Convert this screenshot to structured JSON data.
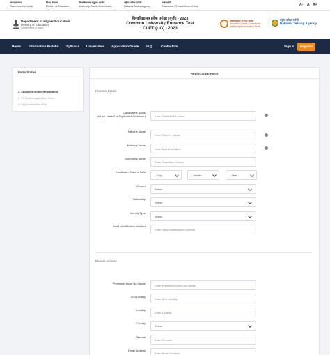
{
  "gov_links": [
    {
      "hi": "भारत सरकार",
      "en": "Government of India"
    },
    {
      "hi": "शिक्षा मंत्रालय",
      "en": "Ministry of Education"
    },
    {
      "hi": "विश्वविद्यालय अनुदान आयोग",
      "en": "University Grants Commission"
    },
    {
      "hi": "राष्ट्रीय परीक्षा एजेंसी",
      "en": "National Testing Agency"
    },
    {
      "hi": "आईआईटी",
      "en": "Grievance: IIT Institutions of Hed"
    }
  ],
  "accessibility": {
    "small": "A-",
    "normal": "A",
    "large": "A+"
  },
  "header": {
    "dept_name": "Department of Higher Education",
    "dept_sub": "Ministry of Education",
    "dept_gov": "Government of India",
    "title_hi": "विश्वविद्यालय प्रवेश परीक्षा (यूजी) - 2023",
    "title_1": "Common University Entrance Test",
    "title_2": "CUET (UG) - 2023",
    "ugc_hi": "विश्वविद्यालय अनुदान आयोग",
    "ugc_en": "University Grants Commission",
    "ugc_tag": "quality higher education for all",
    "nta_hi": "राष्ट्रीय परीक्षा एजेंसी",
    "nta_en": "National Testing Agency"
  },
  "nav": {
    "items": [
      "Home",
      "Information Bulletin",
      "Syllabus",
      "Universities",
      "Application Guide",
      "FAQ",
      "Contact Us"
    ],
    "signin": "Sign In",
    "register": "Register"
  },
  "form_status": {
    "title": "Form Status",
    "steps": [
      "1. Apply for Online Registration",
      "2. Fill Online Application Form",
      "3. Pay Examination Fee"
    ]
  },
  "registration": {
    "title": "Registration Form",
    "personal_section": "Personal Details",
    "name_label": "Candidate's Name",
    "name_note": "(As per class X or Equivalent Certificate)",
    "name_ph": "Enter Candidate's Name",
    "father_label": "Father's Name",
    "father_ph": "Enter Father's Name",
    "mother_label": "Mother's Name",
    "mother_ph": "Enter Mother's Name",
    "guardian_label": "Guardian's Name",
    "guardian_ph": "Enter Guardian's Name",
    "dob_label": "Candidate's Date of Birth",
    "dob_day": "--Day--",
    "dob_month": "--Month--",
    "dob_year": "--Year--",
    "gender_label": "Gender",
    "gender_value": "Select",
    "nationality_label": "Nationality",
    "nationality_value": "Select",
    "identity_label": "Identity Type",
    "identity_value": "Select",
    "idnum_label": "Valid Identification Number",
    "idnum_ph": "Enter Valid Identification Number",
    "present_section": "Present Address",
    "premises_label": "Premises/House No./Name",
    "premises_ph": "Enter Premises/House No./Name",
    "sublocality_label": "Sub Locality",
    "sublocality_ph": "Enter Sub Locality",
    "locality_label": "Locality",
    "locality_ph": "Enter Locality",
    "country_label": "Country",
    "country_value": "Select",
    "pincode_label": "Pincode",
    "pincode_ph": "Enter Pincode",
    "email_label": "Email Address",
    "email_ph": "Enter Email Address"
  },
  "colors": {
    "nav_bg": "#1d2a44",
    "accent": "#f28a1a"
  }
}
